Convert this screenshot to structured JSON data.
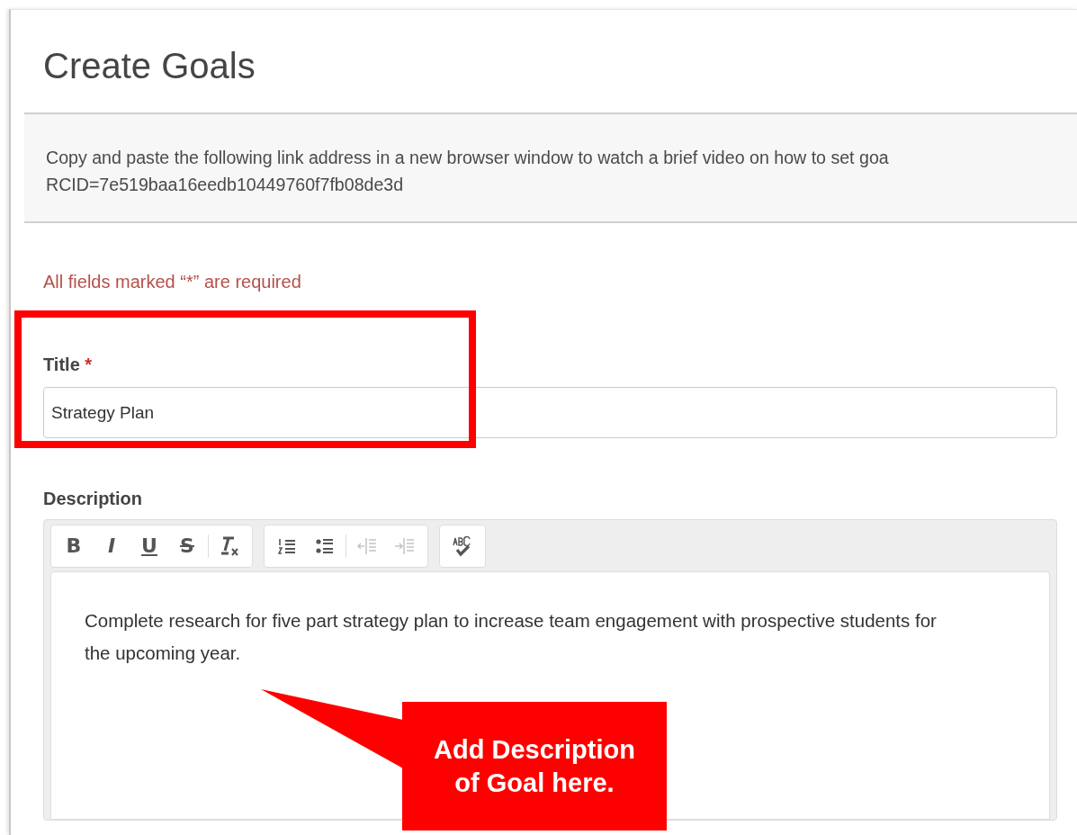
{
  "page": {
    "title": "Create Goals"
  },
  "info": {
    "lines": [
      "Copy and paste the following link address in a new browser window to watch a brief video on how to set goa",
      "RCID=7e519baa16eedb10449760f7fb08de3d"
    ]
  },
  "required_note": "All fields marked “*” are required",
  "title_field": {
    "label": "Title",
    "required_mark": "*",
    "value": "Strategy Plan"
  },
  "description": {
    "label": "Description",
    "toolbar": [
      {
        "buttons": [
          {
            "kind": "bold",
            "label": "B",
            "disabled": false
          },
          {
            "kind": "italic",
            "label": "I",
            "disabled": false
          },
          {
            "kind": "underline",
            "label": "U",
            "disabled": false
          },
          {
            "kind": "strike",
            "label": "S",
            "disabled": false
          },
          {
            "kind": "separator"
          },
          {
            "kind": "clear-format",
            "disabled": false
          }
        ]
      },
      {
        "buttons": [
          {
            "kind": "numbered-list",
            "disabled": false
          },
          {
            "kind": "bulleted-list",
            "disabled": false
          },
          {
            "kind": "separator"
          },
          {
            "kind": "outdent",
            "disabled": true
          },
          {
            "kind": "indent",
            "disabled": true
          }
        ]
      },
      {
        "buttons": [
          {
            "kind": "spellcheck",
            "disabled": false
          }
        ]
      }
    ],
    "text": "Complete research for five part strategy plan to increase team engagement with prospective students for the upcoming year."
  },
  "callout": {
    "lines": [
      "Add Description",
      "of Goal here."
    ]
  }
}
